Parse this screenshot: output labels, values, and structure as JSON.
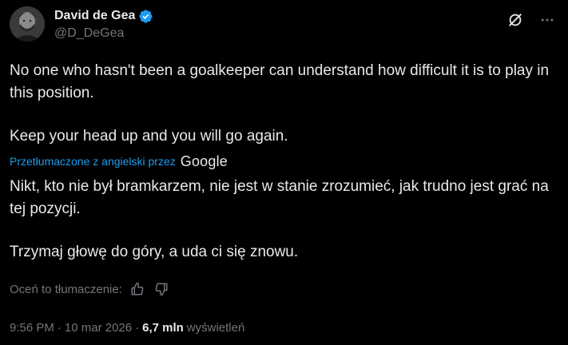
{
  "author": {
    "display_name": "David de Gea",
    "handle": "@D_DeGea",
    "verified": true
  },
  "header_actions": {
    "grok_icon": "grok-icon",
    "more_icon": "more-icon"
  },
  "tweet": {
    "original_paragraphs": [
      "No one who hasn't been a goalkeeper can understand how difficult it is to play in this position.",
      "Keep your head up and you will go again."
    ],
    "translated_by_label": "Przetłumaczone z angielski przez",
    "translator_brand": "Google",
    "translated_paragraphs": [
      "Nikt, kto nie był bramkarzem, nie jest w stanie zrozumieć, jak trudno jest grać na tej pozycji.",
      "Trzymaj głowę do góry, a uda ci się znowu."
    ]
  },
  "rating": {
    "label": "Oceń to tłumaczenie:",
    "thumbs_up_icon": "thumbs-up-icon",
    "thumbs_down_icon": "thumbs-down-icon"
  },
  "meta": {
    "time": "9:56 PM",
    "separator": "·",
    "date": "10 mar 2026",
    "views_count": "6,7 mln",
    "views_label": "wyświetleń"
  },
  "colors": {
    "background": "#000000",
    "text_primary": "#e7e9ea",
    "text_secondary": "#71767b",
    "link": "#1d9bf0",
    "verified": "#1d9bf0"
  }
}
